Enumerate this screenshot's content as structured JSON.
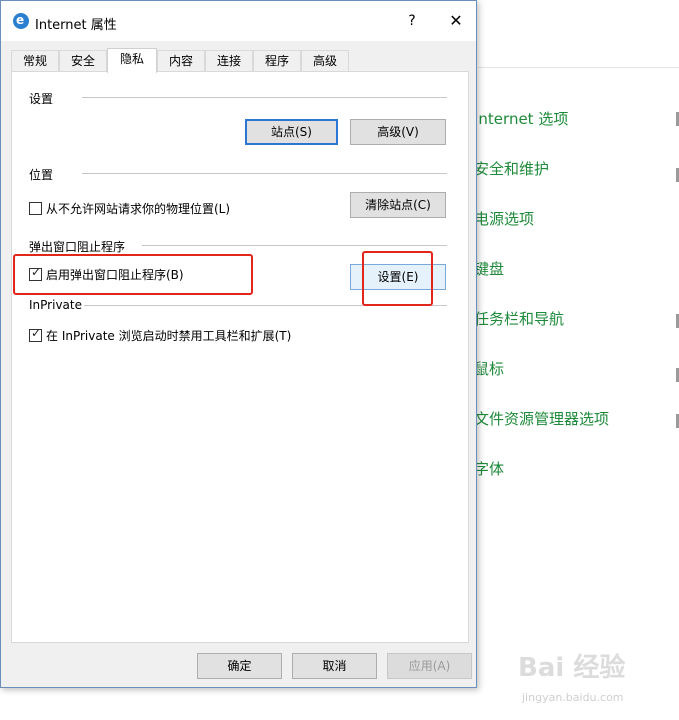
{
  "background_panel": {
    "links": [
      "Internet 选项",
      "安全和维护",
      "电源选项",
      "键盘",
      "任务栏和导航",
      "鼠标",
      "文件资源管理器选项",
      "字体"
    ],
    "watermark_logo": "Bai 经验",
    "watermark_url": "jingyan.baidu.com",
    "link_color": "#1e8a3a"
  },
  "dialog": {
    "title": "Internet 属性",
    "help_label": "?",
    "close_label": "✕",
    "tabs": [
      "常规",
      "安全",
      "隐私",
      "内容",
      "连接",
      "程序",
      "高级"
    ],
    "active_tab": "隐私",
    "settings_group": {
      "title": "设置",
      "sites_button": "站点(S)",
      "advanced_button": "高级(V)"
    },
    "location_group": {
      "title": "位置",
      "checkbox_label": "从不允许网站请求你的物理位置(L)",
      "checked": false,
      "clear_sites_button": "清除站点(C)"
    },
    "popup_group": {
      "title": "弹出窗口阻止程序",
      "checkbox_label": "启用弹出窗口阻止程序(B)",
      "checked": true,
      "settings_button": "设置(E)"
    },
    "inprivate_group": {
      "title": "InPrivate",
      "checkbox_label": "在 InPrivate 浏览启动时禁用工具栏和扩展(T)",
      "checked": true
    },
    "footer": {
      "ok": "确定",
      "cancel": "取消",
      "apply": "应用(A)"
    },
    "check_mark": "✓",
    "highlight_color": "#e2261c"
  }
}
